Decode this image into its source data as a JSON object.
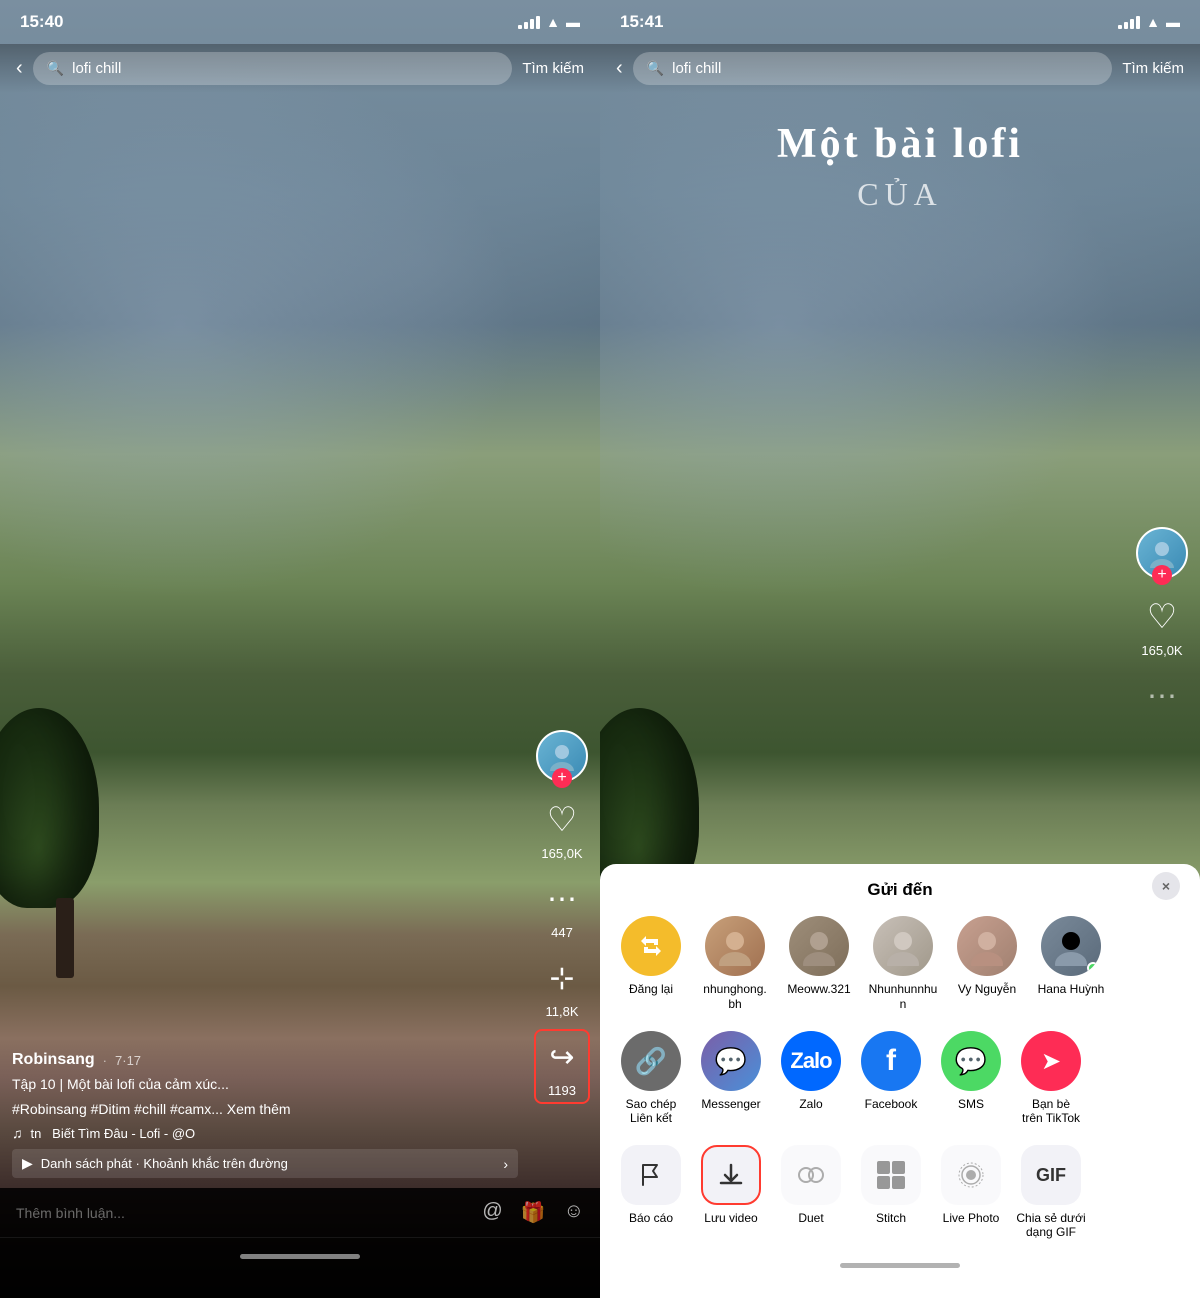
{
  "left_phone": {
    "status_time": "15:40",
    "search_query": "lofi chill",
    "search_placeholder": "Tìm kiếm",
    "likes_count": "165,0K",
    "comments_count": "447",
    "bookmarks_count": "11,8K",
    "shares_count": "1193",
    "username": "Robinsang",
    "date": "7·17",
    "caption": "Tập 10 | Một bài lofi của cảm xúc...",
    "hashtags": "#Robinsang #Ditim #chill #camx... Xem thêm",
    "music": "♫ tn   Biết Tìm Đâu - Lofi - @O",
    "playlist": "Danh sách phát · Khoảnh khắc trên đường",
    "comment_placeholder": "Thêm bình luận..."
  },
  "right_phone": {
    "status_time": "15:41",
    "search_query": "lofi chill",
    "search_placeholder": "Tìm kiếm",
    "likes_count": "165,0K",
    "video_title": "Một bài lofi",
    "video_subtitle": "CỦA",
    "share_sheet": {
      "title": "Gửi đến",
      "close_label": "×",
      "friends": [
        {
          "name": "Đăng lại",
          "color": "#f4bc2b",
          "icon": "🔄",
          "type": "app"
        },
        {
          "name": "nhunghong.\nbh",
          "color": "#c8a07a",
          "icon": "",
          "type": "avatar"
        },
        {
          "name": "Meoww.321",
          "color": "#9e8e7a",
          "icon": "",
          "type": "avatar"
        },
        {
          "name": "Nhunhunnhu\nn",
          "color": "#c8c0b8",
          "icon": "",
          "type": "avatar"
        },
        {
          "name": "Vy Nguyễn",
          "color": "#c8a090",
          "icon": "",
          "type": "avatar"
        },
        {
          "name": "Hana Huỳnh",
          "color": "#7a8a9a",
          "icon": "",
          "type": "avatar"
        }
      ],
      "apps": [
        {
          "name": "Sao chép\nLiên kết",
          "color": "#6b6b6b",
          "icon": "🔗"
        },
        {
          "name": "Messenger",
          "color": "#6a5acd",
          "icon": "💬"
        },
        {
          "name": "Zalo",
          "color": "#0068ff",
          "icon": "Z"
        },
        {
          "name": "Facebook",
          "color": "#1877f2",
          "icon": "f"
        },
        {
          "name": "SMS",
          "color": "#4cd964",
          "icon": "💬"
        },
        {
          "name": "Bạn bè\ntrên TikTok",
          "color": "#fe2c55",
          "icon": "→"
        }
      ],
      "actions": [
        {
          "name": "Báo cáo",
          "icon": "flag",
          "highlighted": false,
          "grayed": false
        },
        {
          "name": "Lưu video",
          "icon": "download",
          "highlighted": true,
          "grayed": false
        },
        {
          "name": "Duet",
          "icon": "duet",
          "highlighted": false,
          "grayed": true
        },
        {
          "name": "Stitch",
          "icon": "stitch",
          "highlighted": false,
          "grayed": true
        },
        {
          "name": "Live Photo",
          "icon": "livephoto",
          "highlighted": false,
          "grayed": true
        },
        {
          "name": "Chia sẻ dưới\ndạng GIF",
          "icon": "gif",
          "highlighted": false,
          "grayed": false
        }
      ]
    }
  }
}
